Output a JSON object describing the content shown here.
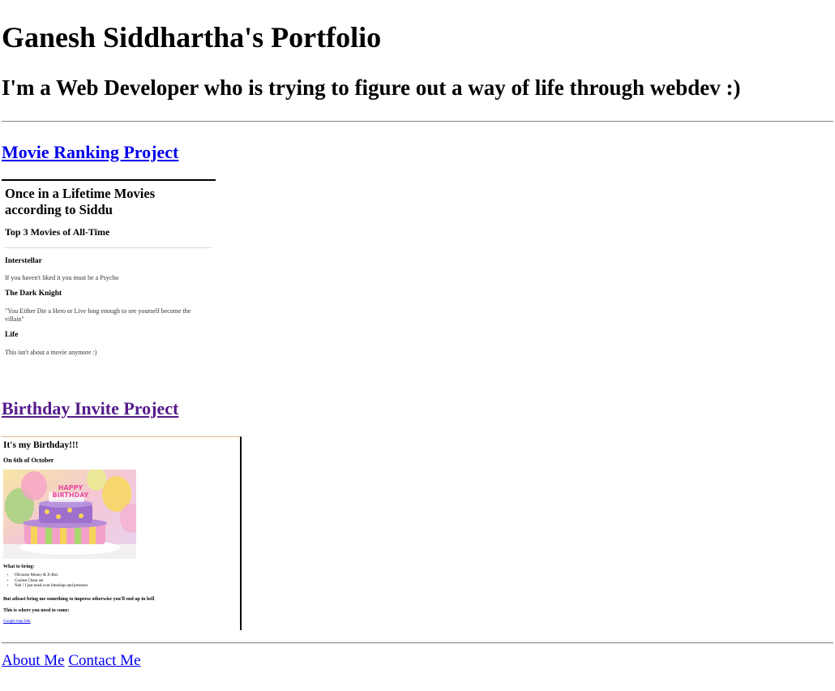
{
  "header": {
    "title": "Ganesh Siddhartha's Portfolio",
    "subtitle": "I'm a Web Developer who is trying to figure out a way of life through webdev :)"
  },
  "projects": [
    {
      "link_label": "Movie Ranking Project",
      "preview": {
        "title": "Once in a Lifetime Movies according to Siddu",
        "subtitle": "Top 3 Movies of All-Time",
        "movies": [
          {
            "name": "Interstellar",
            "description": "If you haven't liked it you must be a Psycho"
          },
          {
            "name": "The Dark Knight",
            "description": "\"You Either Die a Hero or Live long enough to see yourself become the villain\""
          },
          {
            "name": "Life",
            "description": "This isn't about a movie anymore :)"
          }
        ]
      }
    },
    {
      "link_label": "Birthday Invite Project",
      "preview": {
        "title": "It's my Birthday!!!",
        "date": "On 6th of October",
        "cake_text": "HAPPY BIRTHDAY",
        "bring_heading": "What to bring:",
        "bring_items": [
          "Ofcourse Money & X-Box",
          "Coolest Chess set",
          "Nah ! I just need your blessings and presence"
        ],
        "atleast_text": "But atleast bring me something to impress otherwise you'll end up in hell",
        "where_text": "This is where you need to come:",
        "map_link": "Google map link"
      }
    }
  ],
  "footer": {
    "about_label": "About Me",
    "contact_label": "Contact Me"
  },
  "colors": {
    "link": "#0000ee",
    "visited_link": "#551a8b",
    "rule": "#8a8a8a"
  }
}
